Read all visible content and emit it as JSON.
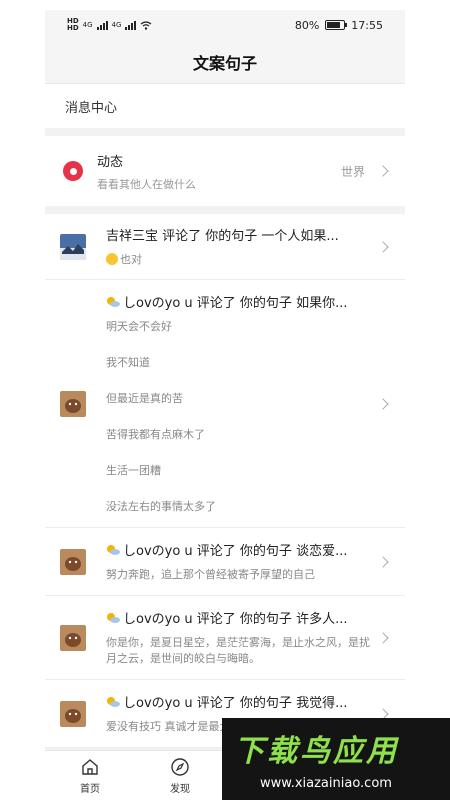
{
  "status_bar": {
    "battery": "80%",
    "time": "17:55",
    "sim1": "HD",
    "sim2": "HD",
    "net": "4G"
  },
  "header": {
    "title": "文案句子"
  },
  "message_center": {
    "label": "消息中心"
  },
  "dynamic": {
    "title": "动态",
    "subtitle": "看看其他人在做什么",
    "world_label": "世界"
  },
  "messages": [
    {
      "user": "吉祥三宝 评论了 你的句子 一个人如果...",
      "lines": [
        "也对"
      ]
    },
    {
      "user": "しovのyo u  评论了 你的句子 如果你...",
      "lines": [
        "明天会不会好",
        "我不知道",
        "但最近是真的苦",
        "苦得我都有点麻木了",
        "生活一团糟",
        "没法左右的事情太多了"
      ]
    },
    {
      "user": "しovのyo u  评论了 你的句子 谈恋爱...",
      "lines": [
        "努力奔跑，追上那个曾经被寄予厚望的自己"
      ]
    },
    {
      "user": "しovのyo u  评论了 你的句子 许多人...",
      "lines": [
        "你是你，是夏日星空，是茫茫雾海，是止水之风，是扰月之云，是世间的皎白与晦暗。"
      ]
    },
    {
      "user": "しovのyo u  评论了 你的句子 我觉得...",
      "lines": [
        "爱没有技巧 真诚才是最大的底牌"
      ]
    }
  ],
  "nav": {
    "home": "首页",
    "discover": "发现"
  },
  "watermark": {
    "title": "下载鸟应用",
    "url": "www.xiazainiao.com"
  }
}
